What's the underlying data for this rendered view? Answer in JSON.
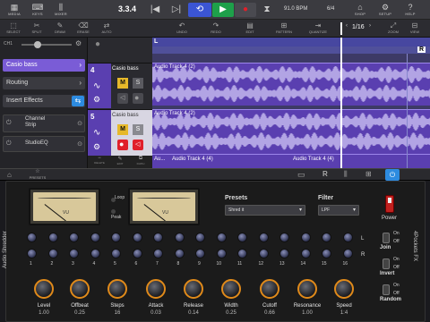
{
  "topbar": {
    "left_icons": [
      {
        "glyph": "▦",
        "label": "MEDIA",
        "icon": "media-icon"
      },
      {
        "glyph": "⌨",
        "label": "KEYS",
        "icon": "keys-icon"
      },
      {
        "glyph": "⫼",
        "label": "MIXER",
        "icon": "mixer-icon"
      }
    ],
    "bar_position": "3.3.4",
    "transport": {
      "rewind": "|◀",
      "forward": "▷|",
      "loop": "⟲",
      "play": "▶",
      "record": "●"
    },
    "metronome_glyph": "⧗",
    "bpm": "91.0 BPM",
    "time_sig": "6/4",
    "right_icons": [
      {
        "glyph": "⌂",
        "label": "SHOP",
        "icon": "shop-icon"
      },
      {
        "glyph": "⚙",
        "label": "SETUP",
        "icon": "setup-icon"
      },
      {
        "glyph": "?",
        "label": "HELP",
        "icon": "help-icon"
      }
    ]
  },
  "toolbar2": {
    "left_tools": [
      {
        "glyph": "⬚",
        "label": "SELECT",
        "icon": "select-icon"
      },
      {
        "glyph": "✂",
        "label": "SPLIT",
        "icon": "split-icon"
      },
      {
        "glyph": "✎",
        "label": "DRAW",
        "icon": "draw-icon"
      },
      {
        "glyph": "⌫",
        "label": "ERASE",
        "icon": "erase-icon"
      },
      {
        "glyph": "⇄",
        "label": "AUTO",
        "icon": "auto-icon"
      }
    ],
    "center_tools": [
      {
        "glyph": "↶",
        "label": "UNDO",
        "icon": "undo-icon"
      },
      {
        "glyph": "↷",
        "label": "REDO",
        "icon": "redo-icon"
      },
      {
        "glyph": "▤",
        "label": "EDIT",
        "icon": "edit-icon"
      },
      {
        "glyph": "⊞",
        "label": "PATTERN",
        "icon": "pattern-icon"
      },
      {
        "glyph": "⇥",
        "label": "QUANTIZE",
        "icon": "quantize-icon"
      }
    ],
    "grid": "1/16",
    "right_tools": [
      {
        "glyph": "⤢",
        "label": "ZOOM",
        "icon": "zoom-icon"
      },
      {
        "glyph": "⊟",
        "label": "VIEW",
        "icon": "view-icon"
      }
    ]
  },
  "left_panel": {
    "volume_label": "CH1",
    "instrument": "Casio bass",
    "routing": "Routing",
    "insert_effects": "Insert Effects",
    "effects": [
      "Channel Strip",
      "StudioEQ"
    ]
  },
  "tracks": [
    {
      "number": "4",
      "name": "Casio bass",
      "buttons": [
        "M",
        "S"
      ]
    },
    {
      "number": "5",
      "name": "Casio bass",
      "buttons": [
        "M",
        "S"
      ]
    }
  ],
  "track_footer": {
    "labels": [
      "DELETE",
      "EDIT",
      "DUPLI"
    ]
  },
  "arrange": {
    "markers": [
      "L",
      "R"
    ],
    "regions": [
      {
        "label": "Audio Track 4 (2)"
      },
      {
        "label": "Audio Track 4 (2)"
      },
      {
        "label": "Au..."
      },
      {
        "label": "Audio Track 4 (4)"
      },
      {
        "label": "Audio Track 4 (4)"
      }
    ]
  },
  "plugin_bar": {
    "presets_label": "PRESETS",
    "right_icons": [
      "screen-icon",
      "r-icon",
      "keyboard-icon",
      "grid-icon",
      "power-icon"
    ]
  },
  "plugin": {
    "side_title_left": "Audio Shredder",
    "side_title_right": "4Pockets FX",
    "vu_label": "VU",
    "loop_label": "Loop",
    "peak_label": "Peak",
    "presets_title": "Presets",
    "preset_value": "Shred it",
    "filter_title": "Filter",
    "filter_value": "LPF",
    "power_label": "Power",
    "lr": [
      "L",
      "R"
    ],
    "step_numbers": [
      "1",
      "2",
      "3",
      "4",
      "5",
      "6",
      "7",
      "8",
      "9",
      "10",
      "11",
      "12",
      "13",
      "14",
      "15",
      "16"
    ],
    "knobs": [
      {
        "name": "Level",
        "value": "1.00"
      },
      {
        "name": "Offbeat",
        "value": "0.25"
      },
      {
        "name": "Steps",
        "value": "16"
      },
      {
        "name": "Attack",
        "value": "0.03"
      },
      {
        "name": "Release",
        "value": "0.14"
      },
      {
        "name": "Width",
        "value": "0.25"
      },
      {
        "name": "Cutoff",
        "value": "0.66"
      },
      {
        "name": "Resonance",
        "value": "1.00"
      },
      {
        "name": "Speed",
        "value": "1:4"
      }
    ],
    "switches": [
      {
        "on": "On",
        "off": "Off",
        "label": "Join"
      },
      {
        "on": "On",
        "off": "Off",
        "label": "Invert"
      },
      {
        "on": "On",
        "off": "Off",
        "label": "Random"
      }
    ]
  },
  "colors": {
    "accent": "#e08a1a",
    "record": "#e0202a",
    "play": "#1ea04a",
    "loop": "#3b55d4",
    "region": "#5a3fb0",
    "power": "#2d8be0"
  }
}
